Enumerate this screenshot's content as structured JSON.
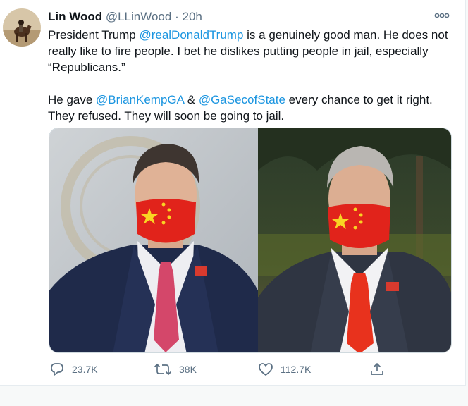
{
  "tweet": {
    "display_name": "Lin Wood",
    "handle": "@LLinWood",
    "separator": "·",
    "time": "20h",
    "text": {
      "p1_a": "President Trump ",
      "p1_mention": "@realDonaldTrump",
      "p1_b": " is a genuinely good man. He does not really like to fire people. I bet he dislikes putting people in jail, especially “Republicans.”",
      "p2_a": "He gave ",
      "p2_mention1": "@BrianKempGA",
      "p2_b": " & ",
      "p2_mention2": "@GaSecofState",
      "p2_c": " every chance to get it right. They refused. They will soon be going to jail."
    }
  },
  "stats": {
    "replies": "23.7K",
    "retweets": "38K",
    "likes": "112.7K"
  },
  "icons": {
    "more": "more-horizontal-icon",
    "reply": "reply-icon",
    "retweet": "retweet-icon",
    "like": "heart-icon",
    "share": "share-icon"
  },
  "colors": {
    "link": "#1b95e0",
    "muted": "#5b7083",
    "text": "#0f1419"
  }
}
